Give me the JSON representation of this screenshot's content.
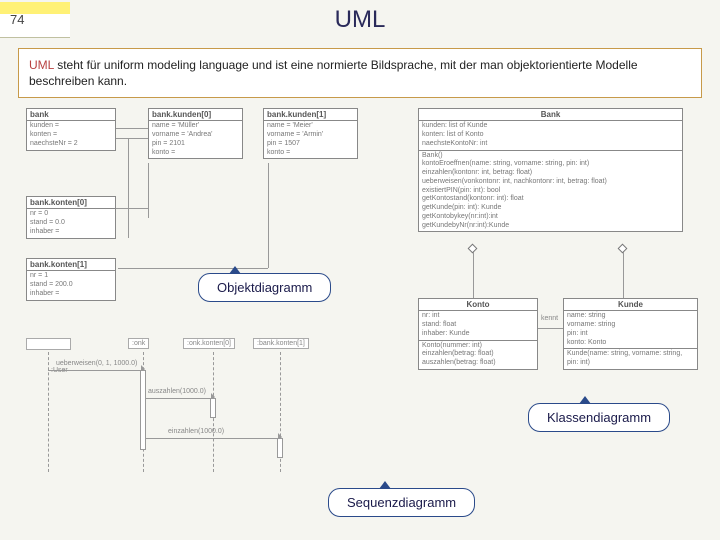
{
  "slide": {
    "number": "74",
    "title": "UML"
  },
  "intro": {
    "highlight": "UML",
    "rest": " steht für uniform modeling language und ist eine normierte Bildsprache, mit der man objektorientierte Modelle beschreiben kann."
  },
  "object_diagram": {
    "bank": {
      "title": "bank",
      "attrs": [
        "kunden = ",
        "konten = ",
        "naechsteNr = 2"
      ]
    },
    "kunde0": {
      "title": "bank.kunden[0]",
      "attrs": [
        "name = 'Müller'",
        "vorname = 'Andrea'",
        "pin = 2101",
        "konto = "
      ]
    },
    "kunde1": {
      "title": "bank.kunden[1]",
      "attrs": [
        "name = 'Meier'",
        "vorname = 'Armin'",
        "pin = 1507",
        "konto = "
      ]
    },
    "konto0": {
      "title": "bank.konten[0]",
      "attrs": [
        "nr = 0",
        "stand = 0.0",
        "inhaber = "
      ]
    },
    "konto1": {
      "title": "bank.konten[1]",
      "attrs": [
        "nr = 1",
        "stand = 200.0",
        "inhaber = "
      ]
    }
  },
  "class_diagram": {
    "bank": {
      "title": "Bank",
      "attrs": [
        "kunden: list of Kunde",
        "konten: list of Konto",
        "naechsteKontoNr: int"
      ],
      "ops": [
        "Bank()",
        "kontoEroeffnen(name: string, vorname: string, pin: int)",
        "einzahlen(kontonr: int, betrag: float)",
        "ueberweisen(vonkontonr: int, nachkontonr: int, betrag: float)",
        "existiertPIN(pin: int): bool",
        "getKontostand(kontonr: int): float",
        "getKunde(pin: int): Kunde",
        "getKontobykey(nr:int):int",
        "getKundebyNr(nr:int):Kunde"
      ]
    },
    "konto": {
      "title": "Konto",
      "attrs": [
        "nr: int",
        "stand: float",
        "inhaber: Kunde"
      ],
      "ops": [
        "Konto(nummer: int)",
        "einzahlen(betrag: float)",
        "auszahlen(betrag: float)"
      ]
    },
    "kunde": {
      "title": "Kunde",
      "attrs": [
        "name: string",
        "vorname: string",
        "pin: int",
        "konto: Konto"
      ],
      "ops": [
        "Kunde(name: string, vorname: string, pin: int)"
      ]
    }
  },
  "sequence_diagram": {
    "actors": [
      ":onk",
      ":onk.konten[0]",
      ":bank.konten[1]"
    ],
    "lifeline_label": ":User",
    "messages": [
      "ueberweisen(0, 1, 1000.0)",
      "auszahlen(1000.0)",
      "einzahlen(1000.0)"
    ]
  },
  "callouts": {
    "object": "Objektdiagramm",
    "class": "Klassendiagramm",
    "sequence": "Sequenzdiagramm"
  }
}
